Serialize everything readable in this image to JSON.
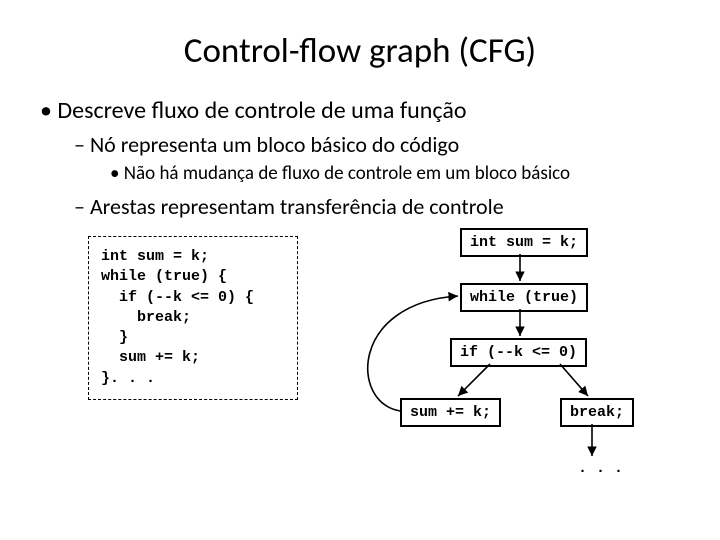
{
  "title": "Control-flow graph (CFG)",
  "bullets": {
    "b1": "Descreve fluxo de controle de uma função",
    "b2a": "Nó representa um bloco básico do código",
    "b3a": "Não há mudança de fluxo de controle em um bloco básico",
    "b2b": "Arestas representam transferência de controle"
  },
  "code": "int sum = k;\nwhile (true) {\n  if (--k <= 0) {\n    break;\n  }\n  sum += k;\n}. . .",
  "nodes": {
    "n1": "int sum = k;",
    "n2": "while (true)",
    "n3": "if (--k <= 0)",
    "n4": "sum += k;",
    "n5": "break;"
  },
  "dots": ". . ."
}
